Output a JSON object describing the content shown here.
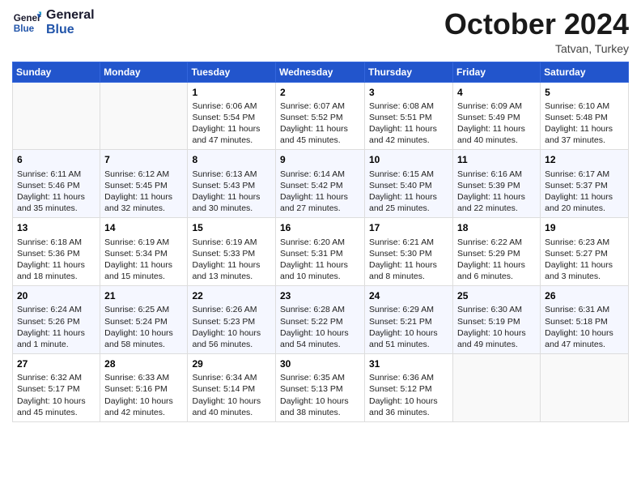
{
  "logo": {
    "line1": "General",
    "line2": "Blue"
  },
  "title": "October 2024",
  "subtitle": "Tatvan, Turkey",
  "header_days": [
    "Sunday",
    "Monday",
    "Tuesday",
    "Wednesday",
    "Thursday",
    "Friday",
    "Saturday"
  ],
  "weeks": [
    [
      {
        "day": "",
        "info": ""
      },
      {
        "day": "",
        "info": ""
      },
      {
        "day": "1",
        "info": "Sunrise: 6:06 AM\nSunset: 5:54 PM\nDaylight: 11 hours and 47 minutes."
      },
      {
        "day": "2",
        "info": "Sunrise: 6:07 AM\nSunset: 5:52 PM\nDaylight: 11 hours and 45 minutes."
      },
      {
        "day": "3",
        "info": "Sunrise: 6:08 AM\nSunset: 5:51 PM\nDaylight: 11 hours and 42 minutes."
      },
      {
        "day": "4",
        "info": "Sunrise: 6:09 AM\nSunset: 5:49 PM\nDaylight: 11 hours and 40 minutes."
      },
      {
        "day": "5",
        "info": "Sunrise: 6:10 AM\nSunset: 5:48 PM\nDaylight: 11 hours and 37 minutes."
      }
    ],
    [
      {
        "day": "6",
        "info": "Sunrise: 6:11 AM\nSunset: 5:46 PM\nDaylight: 11 hours and 35 minutes."
      },
      {
        "day": "7",
        "info": "Sunrise: 6:12 AM\nSunset: 5:45 PM\nDaylight: 11 hours and 32 minutes."
      },
      {
        "day": "8",
        "info": "Sunrise: 6:13 AM\nSunset: 5:43 PM\nDaylight: 11 hours and 30 minutes."
      },
      {
        "day": "9",
        "info": "Sunrise: 6:14 AM\nSunset: 5:42 PM\nDaylight: 11 hours and 27 minutes."
      },
      {
        "day": "10",
        "info": "Sunrise: 6:15 AM\nSunset: 5:40 PM\nDaylight: 11 hours and 25 minutes."
      },
      {
        "day": "11",
        "info": "Sunrise: 6:16 AM\nSunset: 5:39 PM\nDaylight: 11 hours and 22 minutes."
      },
      {
        "day": "12",
        "info": "Sunrise: 6:17 AM\nSunset: 5:37 PM\nDaylight: 11 hours and 20 minutes."
      }
    ],
    [
      {
        "day": "13",
        "info": "Sunrise: 6:18 AM\nSunset: 5:36 PM\nDaylight: 11 hours and 18 minutes."
      },
      {
        "day": "14",
        "info": "Sunrise: 6:19 AM\nSunset: 5:34 PM\nDaylight: 11 hours and 15 minutes."
      },
      {
        "day": "15",
        "info": "Sunrise: 6:19 AM\nSunset: 5:33 PM\nDaylight: 11 hours and 13 minutes."
      },
      {
        "day": "16",
        "info": "Sunrise: 6:20 AM\nSunset: 5:31 PM\nDaylight: 11 hours and 10 minutes."
      },
      {
        "day": "17",
        "info": "Sunrise: 6:21 AM\nSunset: 5:30 PM\nDaylight: 11 hours and 8 minutes."
      },
      {
        "day": "18",
        "info": "Sunrise: 6:22 AM\nSunset: 5:29 PM\nDaylight: 11 hours and 6 minutes."
      },
      {
        "day": "19",
        "info": "Sunrise: 6:23 AM\nSunset: 5:27 PM\nDaylight: 11 hours and 3 minutes."
      }
    ],
    [
      {
        "day": "20",
        "info": "Sunrise: 6:24 AM\nSunset: 5:26 PM\nDaylight: 11 hours and 1 minute."
      },
      {
        "day": "21",
        "info": "Sunrise: 6:25 AM\nSunset: 5:24 PM\nDaylight: 10 hours and 58 minutes."
      },
      {
        "day": "22",
        "info": "Sunrise: 6:26 AM\nSunset: 5:23 PM\nDaylight: 10 hours and 56 minutes."
      },
      {
        "day": "23",
        "info": "Sunrise: 6:28 AM\nSunset: 5:22 PM\nDaylight: 10 hours and 54 minutes."
      },
      {
        "day": "24",
        "info": "Sunrise: 6:29 AM\nSunset: 5:21 PM\nDaylight: 10 hours and 51 minutes."
      },
      {
        "day": "25",
        "info": "Sunrise: 6:30 AM\nSunset: 5:19 PM\nDaylight: 10 hours and 49 minutes."
      },
      {
        "day": "26",
        "info": "Sunrise: 6:31 AM\nSunset: 5:18 PM\nDaylight: 10 hours and 47 minutes."
      }
    ],
    [
      {
        "day": "27",
        "info": "Sunrise: 6:32 AM\nSunset: 5:17 PM\nDaylight: 10 hours and 45 minutes."
      },
      {
        "day": "28",
        "info": "Sunrise: 6:33 AM\nSunset: 5:16 PM\nDaylight: 10 hours and 42 minutes."
      },
      {
        "day": "29",
        "info": "Sunrise: 6:34 AM\nSunset: 5:14 PM\nDaylight: 10 hours and 40 minutes."
      },
      {
        "day": "30",
        "info": "Sunrise: 6:35 AM\nSunset: 5:13 PM\nDaylight: 10 hours and 38 minutes."
      },
      {
        "day": "31",
        "info": "Sunrise: 6:36 AM\nSunset: 5:12 PM\nDaylight: 10 hours and 36 minutes."
      },
      {
        "day": "",
        "info": ""
      },
      {
        "day": "",
        "info": ""
      }
    ]
  ]
}
